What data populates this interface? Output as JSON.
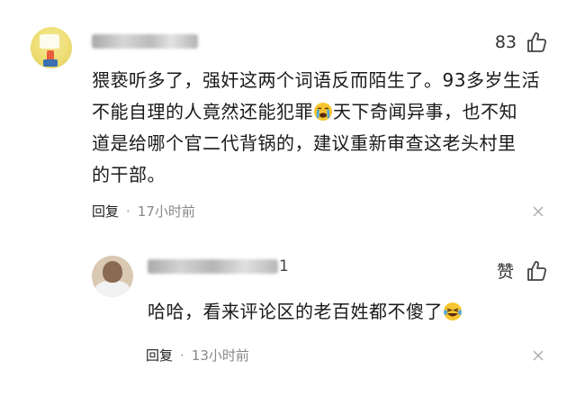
{
  "main_comment": {
    "like_count": "83",
    "text_lines": [
      "猥亵听多了，强奸这两个词语反而陌生了。93多岁生活",
      "不能自理的人竟然还能犯罪",
      "天下奇闻异事，也不知",
      "道是给哪个官二代背锅的，建议重新审查这老头村里",
      "的干部。"
    ],
    "reply_label": "回复",
    "separator": "·",
    "time": "17小时前"
  },
  "reply_comment": {
    "name_tail": "1",
    "like_label": "赞",
    "text": "哈哈，看来评论区的老百姓都不傻了",
    "reply_label": "回复",
    "separator": "·",
    "time": "13小时前"
  },
  "icons": {
    "thumb": "thumbs-up-icon",
    "close": "close-icon",
    "crying_emoji": "crying-emoji-icon",
    "laughing_emoji": "laughing-crying-emoji-icon"
  }
}
